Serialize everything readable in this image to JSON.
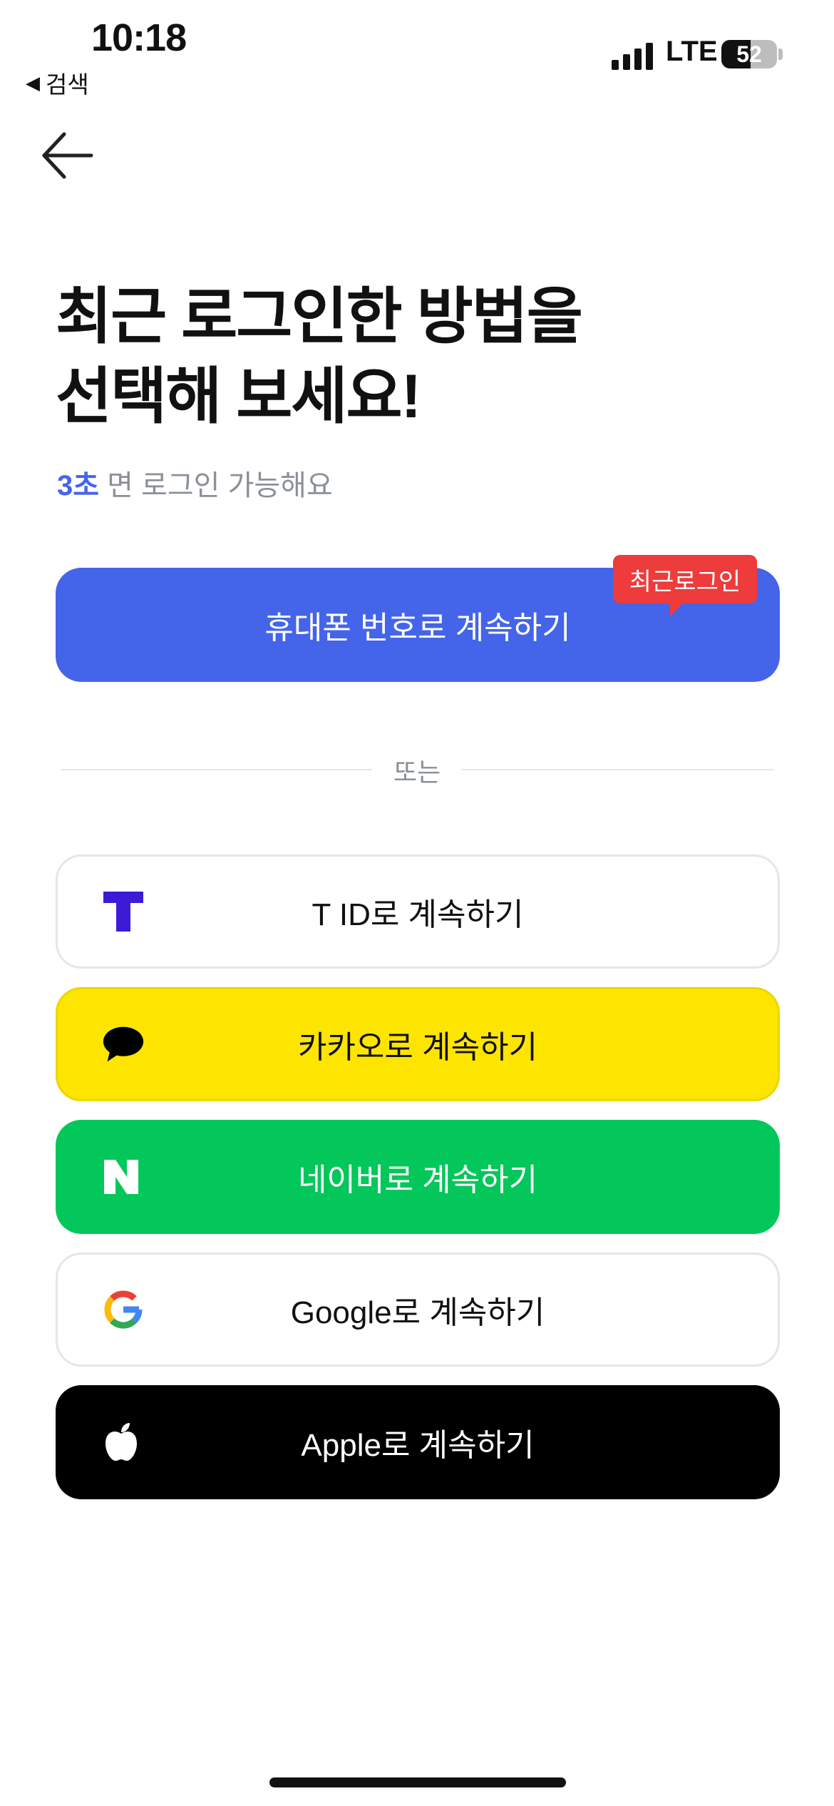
{
  "status_bar": {
    "time": "10:18",
    "back_app_label": "검색",
    "network": "LTE",
    "battery": "52",
    "battery_level_percent": 52
  },
  "header": {
    "back_icon": "arrow-left-icon"
  },
  "headline": {
    "line1": "최근 로그인한 방법을",
    "line2": "선택해 보세요!"
  },
  "subline": {
    "highlight": "3초",
    "rest": " 면 로그인 가능해요"
  },
  "primary_button": {
    "label": "휴대폰 번호로 계속하기",
    "badge": "최근로그인",
    "color": "#4464ea",
    "badge_color": "#ee3b3b"
  },
  "divider": {
    "label": "또는"
  },
  "social_buttons": [
    {
      "label": "T ID로 계속하기",
      "icon": "t-id-logo-icon",
      "color": "#ffffff"
    },
    {
      "label": "카카오로 계속하기",
      "icon": "kakao-speech-bubble-icon",
      "color": "#fee500"
    },
    {
      "label": "네이버로 계속하기",
      "icon": "naver-n-icon",
      "color": "#03c75a"
    },
    {
      "label": "Google로 계속하기",
      "icon": "google-g-icon",
      "color": "#ffffff"
    },
    {
      "label": "Apple로 계속하기",
      "icon": "apple-logo-icon",
      "color": "#000000"
    }
  ]
}
